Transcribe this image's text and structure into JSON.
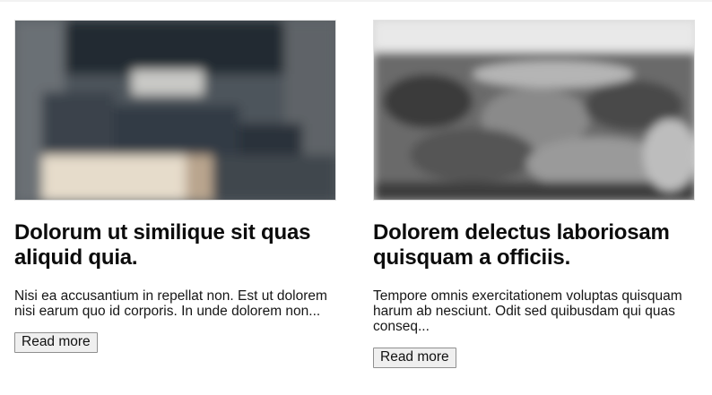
{
  "articles": [
    {
      "image_alt": "article-1-photo",
      "title": "Dolorum ut similique sit quas aliquid quia.",
      "excerpt": "Nisi ea accusantium in repellat non. Est ut dolorem nisi earum quo id corporis. In unde dolorem non...",
      "button_label": "Read more"
    },
    {
      "image_alt": "article-2-photo",
      "title": "Dolorem delectus laboriosam quisquam a officiis.",
      "excerpt": "Tempore omnis exercitationem voluptas quisquam harum ab nesciunt. Odit sed quibusdam qui quas conseq...",
      "button_label": "Read more"
    }
  ]
}
